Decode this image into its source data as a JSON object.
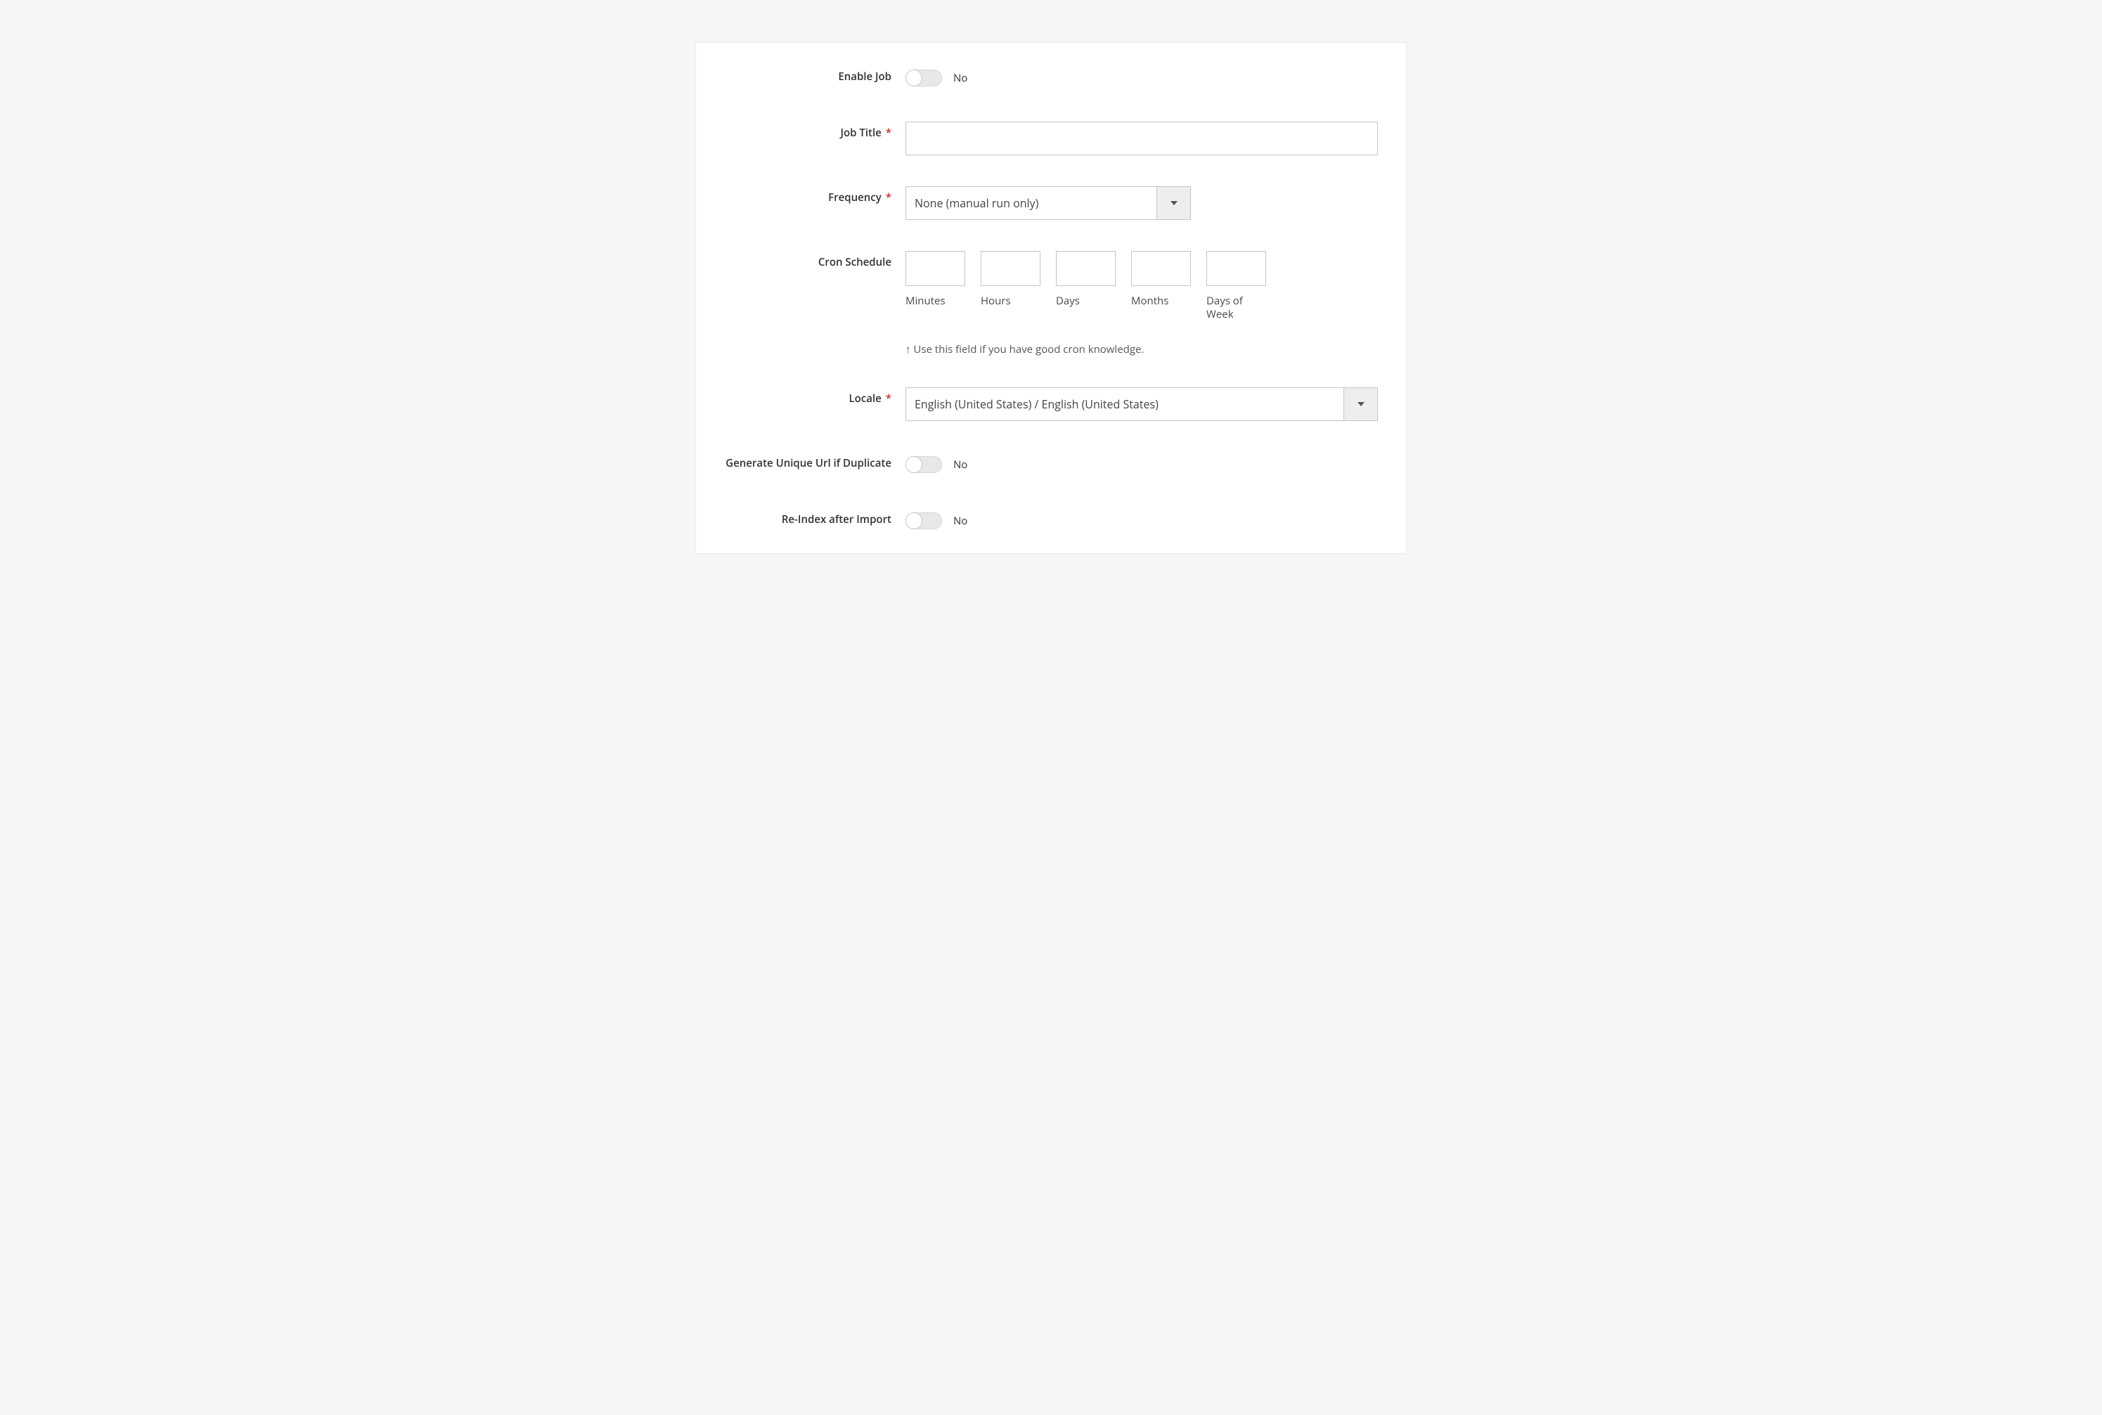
{
  "labels": {
    "enable_job": "Enable Job",
    "job_title": "Job Title",
    "frequency": "Frequency",
    "cron_schedule": "Cron Schedule",
    "locale": "Locale",
    "generate_unique_url": "Generate Unique Url if Duplicate",
    "reindex_after_import": "Re-Index after Import",
    "required_mark": "*"
  },
  "values": {
    "enable_job": "No",
    "job_title": "",
    "frequency": "None (manual run only)",
    "cron": {
      "minutes": "",
      "hours": "",
      "days": "",
      "months": "",
      "dow": ""
    },
    "locale": "English (United States) / English (United States)",
    "generate_unique_url": "No",
    "reindex_after_import": "No"
  },
  "cron_captions": {
    "minutes": "Minutes",
    "hours": "Hours",
    "days": "Days",
    "months": "Months",
    "dow": "Days of Week"
  },
  "cron_hint": "↑ Use this field if you have good cron knowledge."
}
